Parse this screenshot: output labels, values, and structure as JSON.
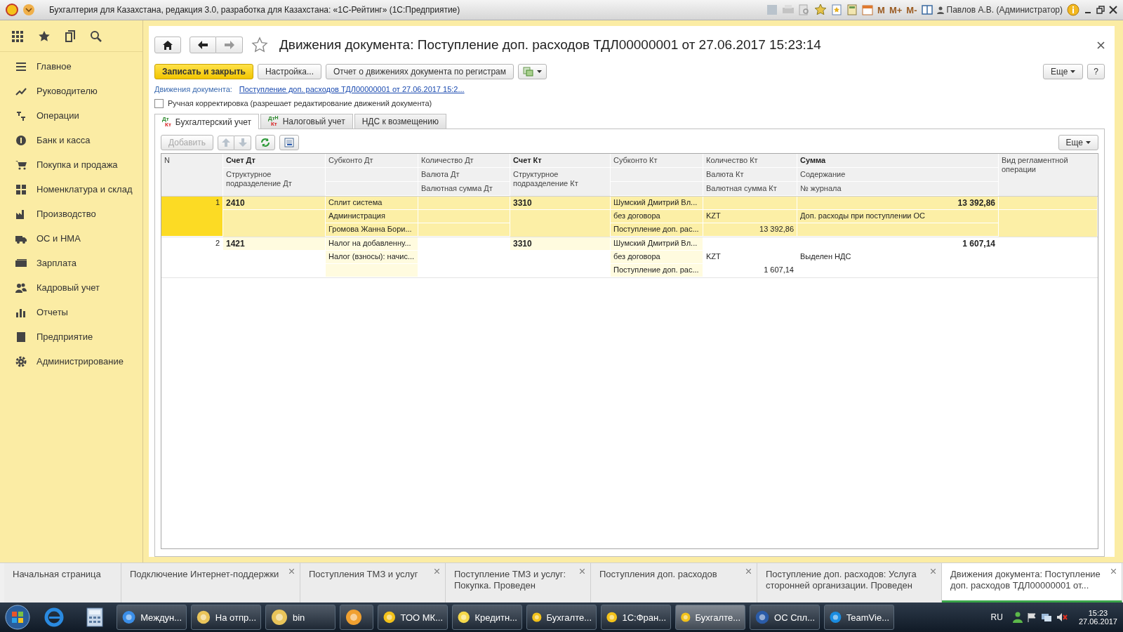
{
  "window": {
    "title": "Бухгалтерия для Казахстана, редакция 3.0, разработка для Казахстана: «1С-Рейтинг»  (1С:Предприятие)",
    "memory_buttons": [
      "M",
      "M+",
      "M-"
    ],
    "user": "Павлов А.В. (Администратор)"
  },
  "sidebar": {
    "items": [
      {
        "label": "Главное"
      },
      {
        "label": "Руководителю"
      },
      {
        "label": "Операции"
      },
      {
        "label": "Банк и касса"
      },
      {
        "label": "Покупка и продажа"
      },
      {
        "label": "Номенклатура и склад"
      },
      {
        "label": "Производство"
      },
      {
        "label": "ОС и НМА"
      },
      {
        "label": "Зарплата"
      },
      {
        "label": "Кадровый учет"
      },
      {
        "label": "Отчеты"
      },
      {
        "label": "Предприятие"
      },
      {
        "label": "Администрирование"
      }
    ]
  },
  "document": {
    "title": "Движения документа: Поступление доп. расходов ТДЛ00000001 от 27.06.2017 15:23:14",
    "toolbar": [
      {
        "label": "Записать и закрыть",
        "kind": "primary"
      },
      {
        "label": "Настройка...",
        "kind": "default"
      },
      {
        "label": "Отчет о движениях документа по регистрам",
        "kind": "default"
      }
    ],
    "more": "Еще",
    "help": "?",
    "movements": {
      "label": "Движения документа:",
      "link": "Поступление доп. расходов ТДЛ00000001 от 27.06.2017 15:2..."
    },
    "manual": {
      "label": "Ручная корректировка (разрешает редактирование движений документа)",
      "checked": false
    },
    "tabs": [
      {
        "label": "Бухгалтерский учет",
        "selected": true,
        "icon": {
          "top": "Дт",
          "bottom": "Кт"
        }
      },
      {
        "label": "Налоговый учет",
        "selected": false,
        "icon": {
          "top": "Дт",
          "mark": "Н",
          "bottom": "Кт"
        }
      },
      {
        "label": "НДС к возмещению",
        "selected": false
      }
    ],
    "add_button": {
      "label": "Добавить",
      "disabled": true
    },
    "table_more": "Еще",
    "table": {
      "columns": [
        {
          "kind": "single",
          "lines": [
            "N"
          ]
        },
        {
          "kind": "account",
          "lines": [
            "Счет Дт",
            "Структурное подразделение Дт"
          ]
        },
        {
          "kind": "multi",
          "lines": [
            "Субконто Дт"
          ]
        },
        {
          "kind": "multi",
          "lines": [
            "Количество Дт",
            "Валюта Дт",
            "Валютная сумма Дт"
          ]
        },
        {
          "kind": "account",
          "lines": [
            "Счет Кт",
            "Структурное подразделение Кт"
          ]
        },
        {
          "kind": "multi",
          "lines": [
            "Субконто Кт"
          ]
        },
        {
          "kind": "multi",
          "lines": [
            "Количество Кт",
            "Валюта Кт",
            "Валютная сумма Кт"
          ]
        },
        {
          "kind": "sum",
          "lines": [
            "Сумма",
            "Содержание",
            "№ журнала"
          ]
        },
        {
          "kind": "single",
          "lines": [
            "Вид регламентной операции"
          ]
        }
      ],
      "rows": [
        {
          "n": "1",
          "selected": true,
          "account_dt": "2410",
          "subconto_dt": [
            "Сплит система",
            "Администрация",
            "Громова Жанна Бори..."
          ],
          "account_kt": "3310",
          "subconto_kt": [
            "Шумский Дмитрий Вл...",
            "без договора",
            "Поступление доп. рас..."
          ],
          "currency_kt": "KZT",
          "currency_amount_kt": "13 392,86",
          "amount": "13 392,86",
          "content": "Доп. расходы при поступлении ОС"
        },
        {
          "n": "2",
          "selected": false,
          "account_dt": "1421",
          "subconto_dt": [
            "Налог на добавленну...",
            "Налог (взносы): начис..."
          ],
          "account_kt": "3310",
          "subconto_kt": [
            "Шумский Дмитрий Вл...",
            "без договора",
            "Поступление доп. рас..."
          ],
          "currency_kt": "KZT",
          "currency_amount_kt": "1 607,14",
          "amount": "1 607,14",
          "content": "Выделен НДС"
        }
      ]
    }
  },
  "open_tabs": [
    {
      "label": "Начальная страница",
      "selected": false,
      "closable": false
    },
    {
      "label": "Подключение Интернет-поддержки",
      "selected": false,
      "closable": true
    },
    {
      "label": "Поступления ТМЗ и услуг",
      "selected": false,
      "closable": true
    },
    {
      "label": "Поступление ТМЗ и услуг: Покупка. Проведен",
      "selected": false,
      "closable": true
    },
    {
      "label": "Поступления доп. расходов",
      "selected": false,
      "closable": true
    },
    {
      "label": "Поступление доп. расходов: Услуга сторонней организации. Проведен",
      "selected": false,
      "closable": true
    },
    {
      "label": "Движения документа: Поступление доп. расходов ТДЛ00000001 от...",
      "selected": true,
      "closable": true
    }
  ],
  "taskbar": {
    "tasks": [
      {
        "label": "Междун...",
        "selected": false
      },
      {
        "label": "На отпр...",
        "selected": false
      },
      {
        "label": "bin",
        "selected": false
      },
      {
        "selected": false
      },
      {
        "label": "ТОО МК...",
        "selected": false
      },
      {
        "label": "Кредитн...",
        "selected": false
      },
      {
        "label": "Бухгалте...",
        "selected": false
      },
      {
        "label": "1С:Фран...",
        "selected": false
      },
      {
        "label": "Бухгалте...",
        "selected": true
      },
      {
        "label": "ОС Спл...",
        "selected": false
      },
      {
        "label": "TeamVie...",
        "selected": false
      }
    ],
    "language": "RU",
    "time": "15:23",
    "date": "27.06.2017"
  }
}
